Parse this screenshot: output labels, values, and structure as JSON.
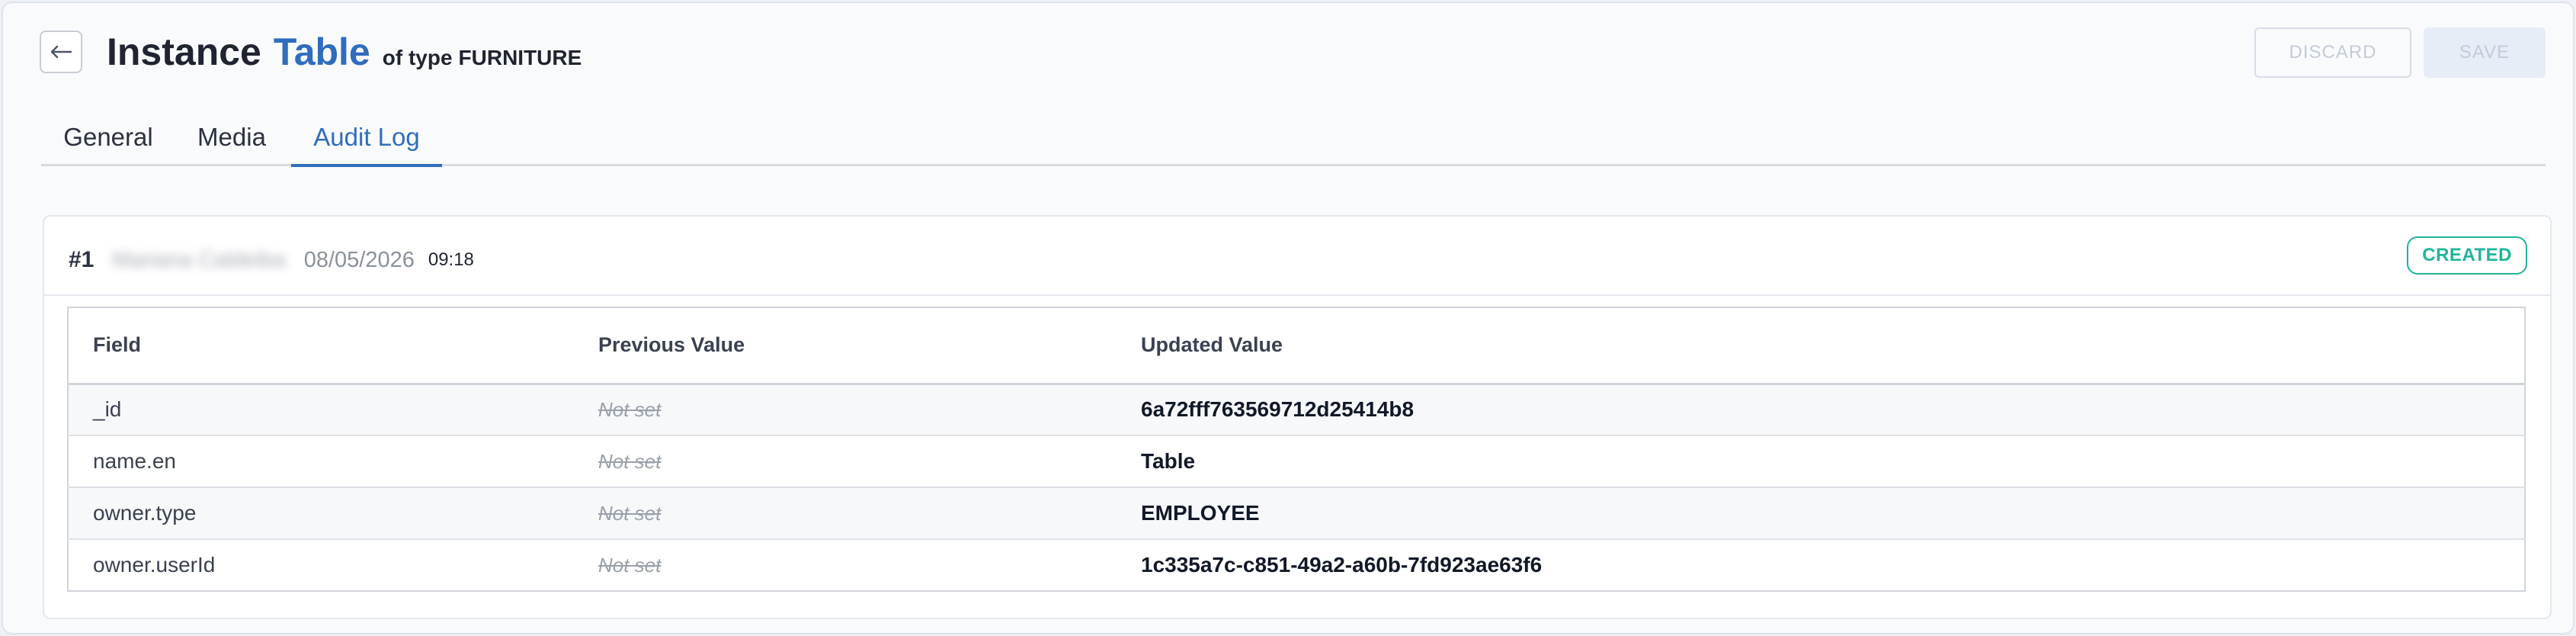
{
  "header": {
    "title_prefix": "Instance",
    "title_name": "Table",
    "of_label": "of type",
    "type_label": "FURNITURE",
    "discard_label": "DISCARD",
    "save_label": "SAVE"
  },
  "tabs": [
    {
      "label": "General"
    },
    {
      "label": "Media"
    },
    {
      "label": "Audit Log",
      "active": true
    }
  ],
  "audit": {
    "entry_number": "#1",
    "user": "Mariana Caldeiba",
    "date": "08/05/2026",
    "time": "09:18",
    "status": "CREATED",
    "columns": [
      "Field",
      "Previous Value",
      "Updated Value"
    ],
    "rows": [
      {
        "field": "_id",
        "previous": "Not set",
        "updated": "6a72fff763569712d25414b8"
      },
      {
        "field": "name.en",
        "previous": "Not set",
        "updated": "Table"
      },
      {
        "field": "owner.type",
        "previous": "Not set",
        "updated": "EMPLOYEE"
      },
      {
        "field": "owner.userId",
        "previous": "Not set",
        "updated": "1c335a7c-c851-49a2-a60b-7fd923ae63f6"
      }
    ]
  },
  "colors": {
    "accent": "#2f6dbd",
    "created_badge": "#1fb59a"
  }
}
